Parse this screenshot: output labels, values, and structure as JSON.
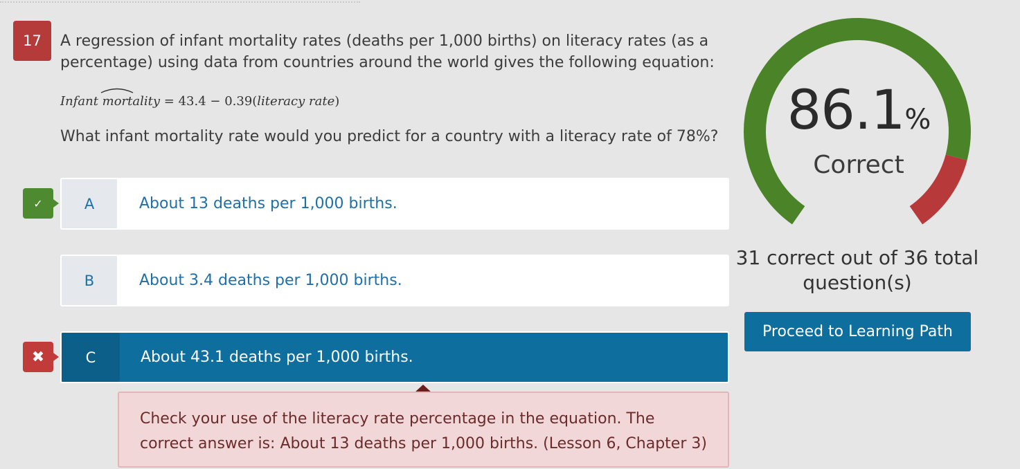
{
  "question": {
    "number": "17",
    "text": "A regression of infant mortality rates (deaths per 1,000 births) on literacy rates (as a percentage) using data from countries around the world gives the following equation:",
    "equation": {
      "lhs": "Infant mortality",
      "rhs_prefix": " = 43.4 − 0.39(",
      "rhs_var": "literacy rate",
      "rhs_suffix": ")"
    },
    "prompt": "What infant mortality rate would you predict for a country with a literacy rate of 78%?"
  },
  "options": [
    {
      "letter": "A",
      "text": "About 13 deaths per 1,000 births.",
      "status": "correct"
    },
    {
      "letter": "B",
      "text": "About 3.4 deaths per 1,000 births.",
      "status": "none"
    },
    {
      "letter": "C",
      "text": "About 43.1 deaths per 1,000 births.",
      "status": "selected-wrong"
    }
  ],
  "markers": {
    "correct_icon": "checkmark-icon",
    "wrong_icon": "cross-icon",
    "correct_glyph": "✓",
    "wrong_glyph": "✖"
  },
  "feedback": {
    "text": "Check your use of the literacy rate percentage in the equation. The correct answer is: About 13 deaths per 1,000 births. (Lesson 6, Chapter 3)"
  },
  "result": {
    "score_value": "86.1",
    "score_unit": "%",
    "score_fraction": 0.861,
    "label": "Correct",
    "summary": "31 correct out of 36 total question(s)",
    "proceed_label": "Proceed to Learning Path"
  },
  "colors": {
    "correct": "#4a8328",
    "incorrect": "#b8393a",
    "accent": "#0e6e9e"
  }
}
